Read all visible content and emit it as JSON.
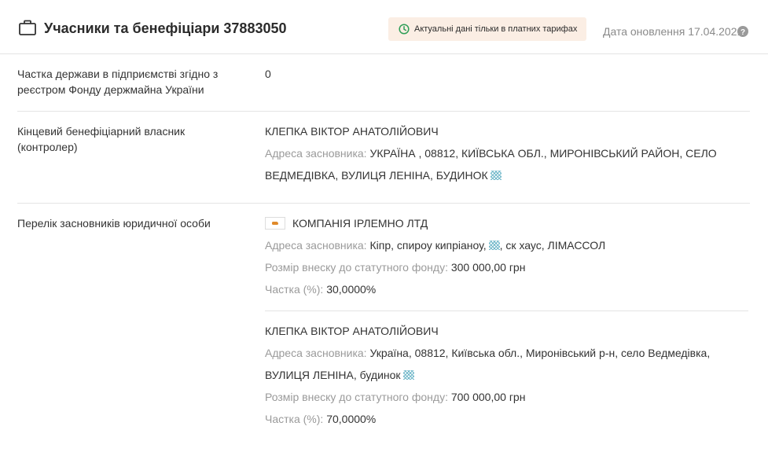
{
  "header": {
    "title": "Учасники та бенефіціари 37883050",
    "badge": "Актуальні дані тільки в платних тарифах",
    "updated": "Дата оновлення 17.04.2021",
    "accent_color": "#2e9e57"
  },
  "rows": {
    "state_share": {
      "label": "Частка держави в підприємстві згідно з реєстром Фонду держмайна України",
      "value": "0"
    },
    "beneficiary": {
      "label": "Кінцевий бенефіціарний власник (контролер)",
      "name": "КЛЕПКА ВІКТОР АНАТОЛІЙОВИЧ",
      "address_label": "Адреса засновника:",
      "address_line1": "УКРАЇНА , 08812, КИЇВСЬКА ОБЛ., МИРОНІВСЬКИЙ РАЙОН, СЕЛО",
      "address_line2": "ВЕДМЕДІВКА, ВУЛИЦЯ ЛЕНІНА, БУДИНОК"
    },
    "founders": {
      "label": "Перелік засновників юридичної особи",
      "items": [
        {
          "name": "КОМПАНІЯ ІРЛЕМНО ЛТД",
          "flag_icon": "cyprus-flag-icon",
          "address_label": "Адреса засновника:",
          "address_part1": "Кіпр, спироу кипріаноу,",
          "address_part2": ", ск хаус, ЛІМАССОЛ",
          "capital_label": "Розмір внеску до статутного фонду:",
          "capital_value": "300 000,00 грн",
          "share_label": "Частка (%):",
          "share_value": "30,0000%"
        },
        {
          "name": "КЛЕПКА ВІКТОР АНАТОЛІЙОВИЧ",
          "address_label": "Адреса засновника:",
          "address_line1": "Україна, 08812, Київська обл., Миронівський р-н, село Ведмедівка,",
          "address_line2": "ВУЛИЦЯ ЛЕНІНА, будинок",
          "capital_label": "Розмір внеску до статутного фонду:",
          "capital_value": "700 000,00 грн",
          "share_label": "Частка (%):",
          "share_value": "70,0000%"
        }
      ]
    }
  }
}
